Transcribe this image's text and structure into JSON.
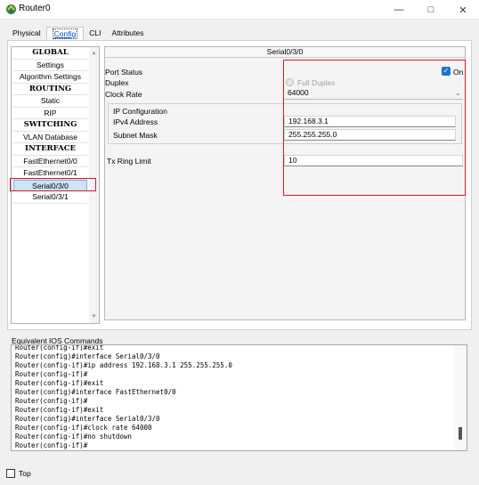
{
  "window": {
    "title": "Router0",
    "buttons": {
      "minimize": "—",
      "maximize": "□",
      "close": "✕"
    }
  },
  "tabs": [
    {
      "label": "Physical",
      "active": false
    },
    {
      "label": "Config",
      "active": true
    },
    {
      "label": "CLI",
      "active": false
    },
    {
      "label": "Attributes",
      "active": false
    }
  ],
  "nav": {
    "items": [
      {
        "label": "GLOBAL",
        "header": true
      },
      {
        "label": "Settings"
      },
      {
        "label": "Algorithm Settings"
      },
      {
        "label": "ROUTING",
        "header": true
      },
      {
        "label": "Static"
      },
      {
        "label": "RIP"
      },
      {
        "label": "SWITCHING",
        "header": true
      },
      {
        "label": "VLAN Database"
      },
      {
        "label": "INTERFACE",
        "header": true
      },
      {
        "label": "FastEthernet0/0"
      },
      {
        "label": "FastEthernet0/1"
      },
      {
        "label": "Serial0/3/0",
        "selected": true
      },
      {
        "label": "Serial0/3/1"
      }
    ]
  },
  "panel": {
    "title": "Serial0/3/0",
    "port_status_label": "Port Status",
    "port_status_value": "On",
    "duplex_label": "Duplex",
    "duplex_value": "Full Duplex",
    "clock_rate_label": "Clock Rate",
    "clock_rate_value": "64000",
    "ip_config_label": "IP Configuration",
    "ipv4_label": "IPv4 Address",
    "ipv4_value": "192.168.3.1",
    "subnet_label": "Subnet Mask",
    "subnet_value": "255.255.255.0",
    "tx_ring_label": "Tx Ring Limit",
    "tx_ring_value": "10"
  },
  "commands": {
    "label": "Equivalent IOS Commands",
    "lines": [
      "Router(config-if)#exit",
      "Router(config)#interface Serial0/3/0",
      "Router(config-if)#ip address 192.168.3.1 255.255.255.0",
      "Router(config-if)#",
      "Router(config-if)#exit",
      "Router(config)#interface FastEthernet0/0",
      "Router(config-if)#",
      "Router(config-if)#exit",
      "Router(config)#interface Serial0/3/0",
      "Router(config-if)#clock rate 64000",
      "Router(config-if)#no shutdown",
      "Router(config-if)#"
    ]
  },
  "footer": {
    "top_label": "Top"
  },
  "colors": {
    "accent": "#1a73d6",
    "highlight": "#e0142a",
    "selected_bg": "#cce4f7"
  }
}
